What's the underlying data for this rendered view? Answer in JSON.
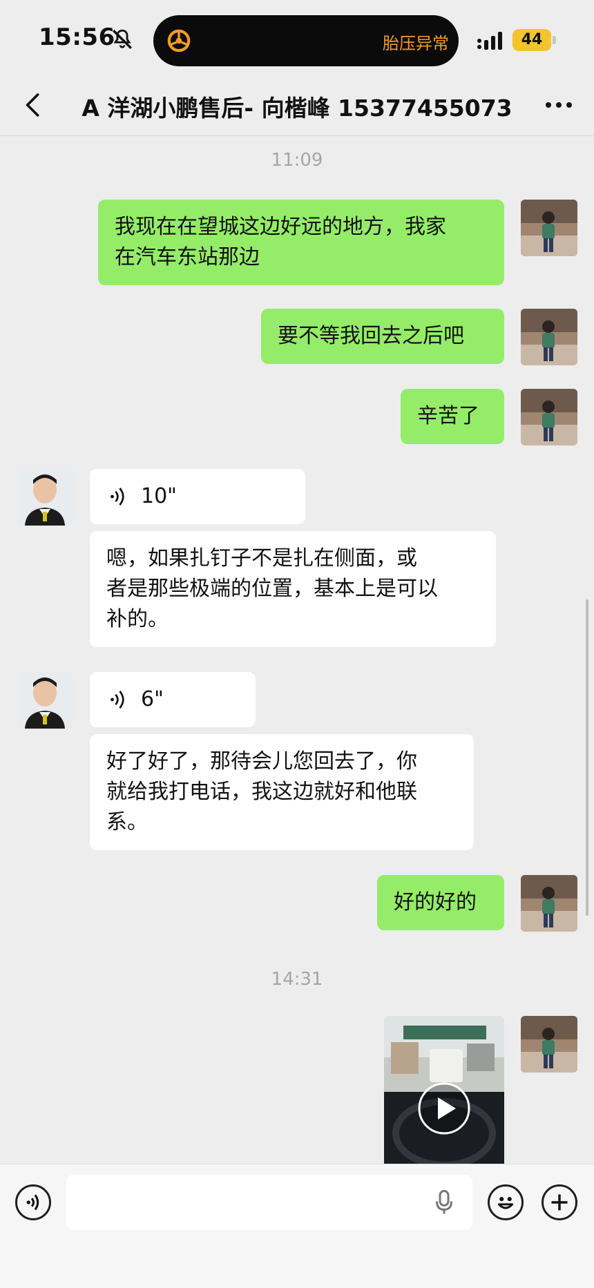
{
  "status_bar": {
    "time": "15:56",
    "island_alert": "胎压异常",
    "battery": "44"
  },
  "nav": {
    "title": "A 洋湖小鹏售后- 向楷峰 15377455073"
  },
  "chat": {
    "timestamps": [
      "11:09",
      "14:31"
    ],
    "messages": [
      {
        "from": "me",
        "type": "text",
        "lines": [
          "我现在在望城这边好远的地方，我家",
          "在汽车东站那边"
        ]
      },
      {
        "from": "me",
        "type": "text",
        "lines": [
          "要不等我回去之后吧"
        ]
      },
      {
        "from": "me",
        "type": "text",
        "lines": [
          "辛苦了"
        ]
      },
      {
        "from": "them",
        "type": "voice",
        "duration": "10\""
      },
      {
        "from": "them",
        "type": "text",
        "lines": [
          "嗯，如果扎钉子不是扎在侧面，或",
          "者是那些极端的位置，基本上是可以",
          "补的。"
        ]
      },
      {
        "from": "them",
        "type": "voice",
        "duration": "6\""
      },
      {
        "from": "them",
        "type": "text",
        "lines": [
          "好了好了，那待会儿您回去了，你",
          "就给我打电话，我这边就好和他联",
          "系。"
        ]
      },
      {
        "from": "me",
        "type": "text",
        "lines": [
          "好的好的"
        ]
      },
      {
        "from": "me",
        "type": "video"
      }
    ]
  },
  "colors": {
    "my_bubble": "#95ec69",
    "their_bubble": "#ffffff",
    "background": "#ededed",
    "alert": "#f59a23",
    "battery": "#f4c330"
  },
  "icons": [
    "bell-slash-icon",
    "tire-icon",
    "signal-icon",
    "back-icon",
    "more-icon",
    "voice-wave-icon",
    "play-icon",
    "voice-input-icon",
    "mic-icon",
    "emoji-icon",
    "plus-icon"
  ]
}
